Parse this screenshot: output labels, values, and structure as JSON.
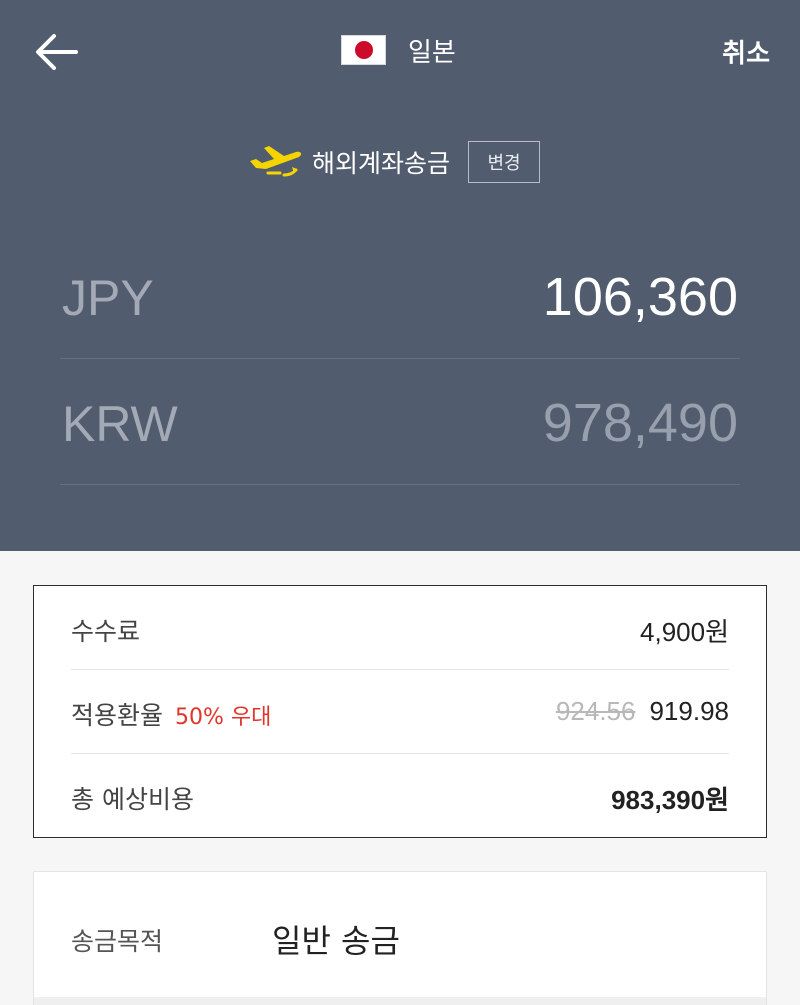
{
  "header": {
    "country": "일본",
    "cancel_label": "취소",
    "method_label": "해외계좌송금",
    "change_label": "변경"
  },
  "amounts": [
    {
      "currency": "JPY",
      "value": "106,360"
    },
    {
      "currency": "KRW",
      "value": "978,490"
    }
  ],
  "fees": {
    "fee_label": "수수료",
    "fee_value": "4,900원",
    "rate_label": "적용환율",
    "rate_badge": "50% 우대",
    "rate_original": "924.56",
    "rate_applied": "919.98",
    "total_label": "총 예상비용",
    "total_value": "983,390원"
  },
  "purpose": {
    "label": "송금목적",
    "value": "일반 송금"
  },
  "colors": {
    "header_bg": "#525c6f",
    "plane_icon": "#f5d400",
    "badge": "#e2342a",
    "total": "#0a5b8d"
  },
  "icons": [
    "back-arrow-icon",
    "japan-flag-icon",
    "airplane-icon"
  ]
}
